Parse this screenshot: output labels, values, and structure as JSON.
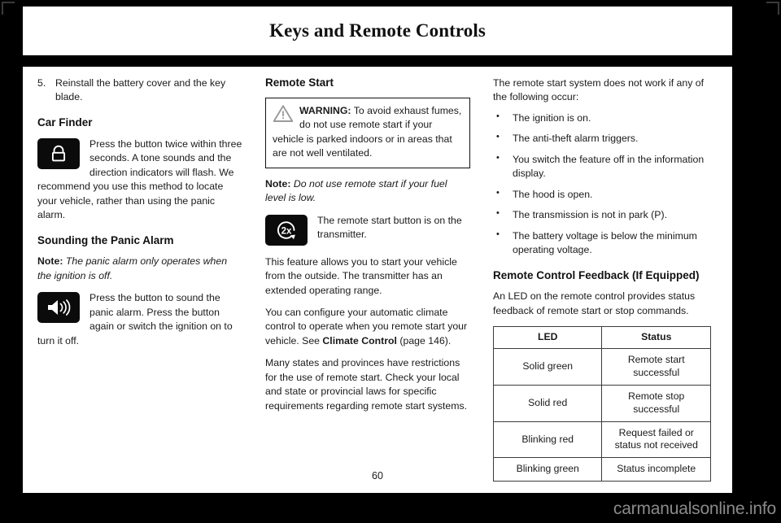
{
  "header": {
    "title": "Keys and Remote Controls"
  },
  "column1": {
    "step": {
      "number": "5.",
      "text": "Reinstall the battery cover and the key blade."
    },
    "car_finder": {
      "heading": "Car Finder",
      "icon_name": "lock-icon",
      "body": "Press the button twice within three seconds.  A tone sounds and the direction indicators will flash.  We recommend you use this method to locate your vehicle, rather than using the panic alarm."
    },
    "panic_alarm": {
      "heading": "Sounding the Panic Alarm",
      "note_label": "Note:",
      "note_text": "The panic alarm only operates when the ignition is off.",
      "icon_name": "speaker-icon",
      "body": "Press the button to sound the panic alarm.  Press the button again or switch the ignition on to turn it off."
    }
  },
  "column2": {
    "heading": "Remote Start",
    "warning": {
      "icon_name": "warning-triangle-icon",
      "label": "WARNING:",
      "text": "To avoid exhaust fumes, do not use remote start if your vehicle is parked indoors or in areas that are not well ventilated."
    },
    "note_label": "Note:",
    "note_text": "Do not use remote start if your fuel level is low.",
    "button_icon_name": "remote-start-2x-icon",
    "button_icon_label": "2x",
    "button_text": "The remote start button is on the transmitter.",
    "para1": "This feature allows you to start your vehicle from the outside.  The transmitter has an extended operating range.",
    "para2_a": "You can configure your automatic climate control to operate when you remote start your vehicle.  See ",
    "para2_ref": "Climate Control",
    "para2_b": " (page 146).",
    "para3": "Many states and provinces have restrictions for the use of remote start.  Check your local and state or provincial laws for specific requirements regarding remote start systems."
  },
  "column3": {
    "intro": "The remote start system does not work if any of the following occur:",
    "bullets": [
      "The ignition is on.",
      "The anti-theft alarm triggers.",
      "You switch the feature off in the information display.",
      "The hood is open.",
      "The transmission is not in park (P).",
      "The battery voltage is below the minimum operating voltage."
    ],
    "feedback_heading": "Remote Control Feedback (If Equipped)",
    "feedback_intro": "An LED on the remote control provides status feedback of remote start or stop commands.",
    "table": {
      "headers": [
        "LED",
        "Status"
      ],
      "rows": [
        [
          "Solid green",
          "Remote start successful"
        ],
        [
          "Solid red",
          "Remote stop successful"
        ],
        [
          "Blinking red",
          "Request failed or status not received"
        ],
        [
          "Blinking green",
          "Status incomplete"
        ]
      ]
    }
  },
  "footer": {
    "page_number": "60",
    "watermark": "carmanualsonline.info"
  }
}
